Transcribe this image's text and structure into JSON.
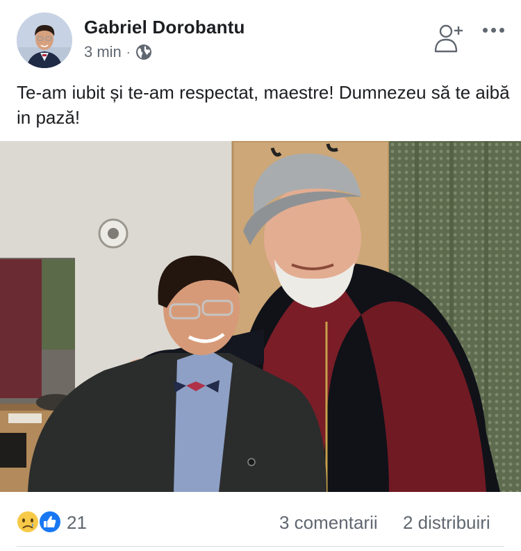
{
  "post": {
    "author": "Gabriel Dorobantu",
    "time": "3 min",
    "separator": "·",
    "privacy_icon": "globe-icon",
    "text": "Te-am iubit și te-am respectat, maestre! Dumnezeu să te aibă in pază!"
  },
  "header_actions": {
    "add_friend_icon": "add-friend-icon",
    "more_icon": "more-options-icon"
  },
  "reactions": {
    "icons": [
      "sad-reaction-icon",
      "like-reaction-icon"
    ],
    "count": "21",
    "comments": "3 comentarii",
    "shares": "2 distribuiri"
  },
  "colors": {
    "text": "#1c1e21",
    "secondary_text": "#606770",
    "like_blue": "#1877f2",
    "sad_yellow": "#f7c948",
    "divider": "#dadde1"
  }
}
